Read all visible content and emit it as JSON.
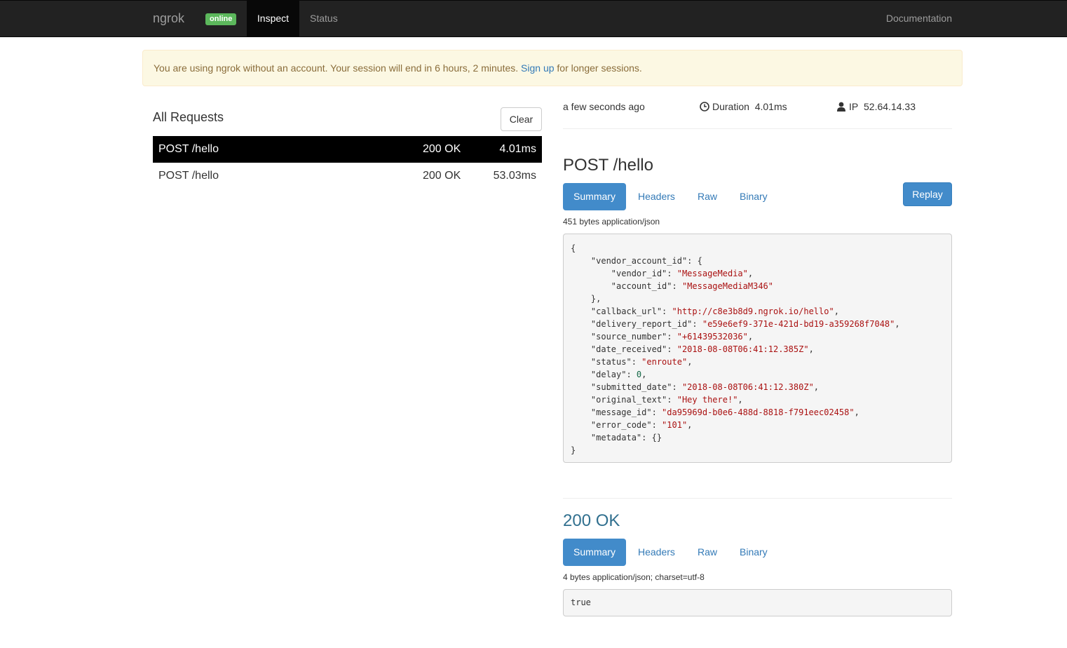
{
  "navbar": {
    "brand": "ngrok",
    "badge": "online",
    "tabs": [
      {
        "label": "Inspect",
        "active": true
      },
      {
        "label": "Status",
        "active": false
      }
    ],
    "docs_label": "Documentation",
    "colors": {
      "bg": "#222222",
      "active": "#080808",
      "badge": "#5cb85c"
    }
  },
  "alert": {
    "text_before": "You are using ngrok without an account. Your session will end in 6 hours, 2 minutes. ",
    "link": "Sign up",
    "text_after": " for longer sessions."
  },
  "requests": {
    "title": "All Requests",
    "clear_label": "Clear",
    "rows": [
      {
        "method": "POST /hello",
        "status": "200 OK",
        "duration": "4.01ms",
        "selected": true
      },
      {
        "method": "POST /hello",
        "status": "200 OK",
        "duration": "53.03ms",
        "selected": false
      }
    ]
  },
  "detail": {
    "time": "a few seconds ago",
    "duration_label": "Duration",
    "duration_value": "4.01ms",
    "ip_label": "IP",
    "ip_value": "52.64.14.33",
    "request": {
      "title": "POST /hello",
      "tabs": [
        "Summary",
        "Headers",
        "Raw",
        "Binary"
      ],
      "replay_label": "Replay",
      "size": "451 bytes application/json",
      "body_lines": [
        [
          {
            "t": "{",
            "c": "k"
          }
        ],
        [
          {
            "t": "    \"vendor_account_id\": {",
            "c": "k"
          }
        ],
        [
          {
            "t": "        \"vendor_id\": ",
            "c": "k"
          },
          {
            "t": "\"MessageMedia\"",
            "c": "s"
          },
          {
            "t": ",",
            "c": "k"
          }
        ],
        [
          {
            "t": "        \"account_id\": ",
            "c": "k"
          },
          {
            "t": "\"MessageMediaM346\"",
            "c": "s"
          }
        ],
        [
          {
            "t": "    },",
            "c": "k"
          }
        ],
        [
          {
            "t": "    \"callback_url\": ",
            "c": "k"
          },
          {
            "t": "\"http://c8e3b8d9.ngrok.io/hello\"",
            "c": "s"
          },
          {
            "t": ",",
            "c": "k"
          }
        ],
        [
          {
            "t": "    \"delivery_report_id\": ",
            "c": "k"
          },
          {
            "t": "\"e59e6ef9-371e-421d-bd19-a359268f7048\"",
            "c": "s"
          },
          {
            "t": ",",
            "c": "k"
          }
        ],
        [
          {
            "t": "    \"source_number\": ",
            "c": "k"
          },
          {
            "t": "\"+61439532036\"",
            "c": "s"
          },
          {
            "t": ",",
            "c": "k"
          }
        ],
        [
          {
            "t": "    \"date_received\": ",
            "c": "k"
          },
          {
            "t": "\"2018-08-08T06:41:12.385Z\"",
            "c": "s"
          },
          {
            "t": ",",
            "c": "k"
          }
        ],
        [
          {
            "t": "    \"status\": ",
            "c": "k"
          },
          {
            "t": "\"enroute\"",
            "c": "s"
          },
          {
            "t": ",",
            "c": "k"
          }
        ],
        [
          {
            "t": "    \"delay\": ",
            "c": "k"
          },
          {
            "t": "0",
            "c": "n"
          },
          {
            "t": ",",
            "c": "k"
          }
        ],
        [
          {
            "t": "    \"submitted_date\": ",
            "c": "k"
          },
          {
            "t": "\"2018-08-08T06:41:12.380Z\"",
            "c": "s"
          },
          {
            "t": ",",
            "c": "k"
          }
        ],
        [
          {
            "t": "    \"original_text\": ",
            "c": "k"
          },
          {
            "t": "\"Hey there!\"",
            "c": "s"
          },
          {
            "t": ",",
            "c": "k"
          }
        ],
        [
          {
            "t": "    \"message_id\": ",
            "c": "k"
          },
          {
            "t": "\"da95969d-b0e6-488d-8818-f791eec02458\"",
            "c": "s"
          },
          {
            "t": ",",
            "c": "k"
          }
        ],
        [
          {
            "t": "    \"error_code\": ",
            "c": "k"
          },
          {
            "t": "\"101\"",
            "c": "s"
          },
          {
            "t": ",",
            "c": "k"
          }
        ],
        [
          {
            "t": "    \"metadata\": {}",
            "c": "k"
          }
        ],
        [
          {
            "t": "}",
            "c": "k"
          }
        ]
      ]
    },
    "response": {
      "title": "200 OK",
      "tabs": [
        "Summary",
        "Headers",
        "Raw",
        "Binary"
      ],
      "size": "4 bytes application/json; charset=utf-8",
      "body": "true"
    }
  }
}
